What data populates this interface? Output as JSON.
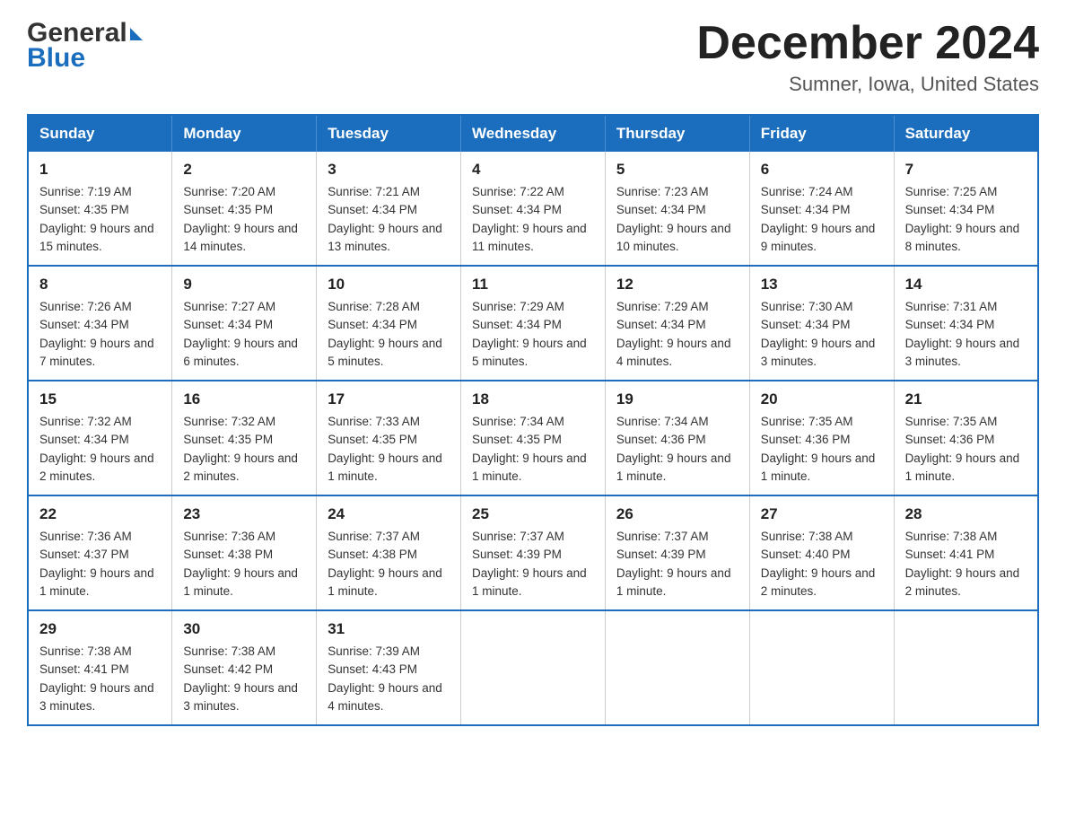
{
  "header": {
    "logo_general": "General",
    "logo_blue": "Blue",
    "month_title": "December 2024",
    "location": "Sumner, Iowa, United States"
  },
  "days_of_week": [
    "Sunday",
    "Monday",
    "Tuesday",
    "Wednesday",
    "Thursday",
    "Friday",
    "Saturday"
  ],
  "weeks": [
    [
      {
        "day": "1",
        "sunrise": "7:19 AM",
        "sunset": "4:35 PM",
        "daylight": "9 hours and 15 minutes."
      },
      {
        "day": "2",
        "sunrise": "7:20 AM",
        "sunset": "4:35 PM",
        "daylight": "9 hours and 14 minutes."
      },
      {
        "day": "3",
        "sunrise": "7:21 AM",
        "sunset": "4:34 PM",
        "daylight": "9 hours and 13 minutes."
      },
      {
        "day": "4",
        "sunrise": "7:22 AM",
        "sunset": "4:34 PM",
        "daylight": "9 hours and 11 minutes."
      },
      {
        "day": "5",
        "sunrise": "7:23 AM",
        "sunset": "4:34 PM",
        "daylight": "9 hours and 10 minutes."
      },
      {
        "day": "6",
        "sunrise": "7:24 AM",
        "sunset": "4:34 PM",
        "daylight": "9 hours and 9 minutes."
      },
      {
        "day": "7",
        "sunrise": "7:25 AM",
        "sunset": "4:34 PM",
        "daylight": "9 hours and 8 minutes."
      }
    ],
    [
      {
        "day": "8",
        "sunrise": "7:26 AM",
        "sunset": "4:34 PM",
        "daylight": "9 hours and 7 minutes."
      },
      {
        "day": "9",
        "sunrise": "7:27 AM",
        "sunset": "4:34 PM",
        "daylight": "9 hours and 6 minutes."
      },
      {
        "day": "10",
        "sunrise": "7:28 AM",
        "sunset": "4:34 PM",
        "daylight": "9 hours and 5 minutes."
      },
      {
        "day": "11",
        "sunrise": "7:29 AM",
        "sunset": "4:34 PM",
        "daylight": "9 hours and 5 minutes."
      },
      {
        "day": "12",
        "sunrise": "7:29 AM",
        "sunset": "4:34 PM",
        "daylight": "9 hours and 4 minutes."
      },
      {
        "day": "13",
        "sunrise": "7:30 AM",
        "sunset": "4:34 PM",
        "daylight": "9 hours and 3 minutes."
      },
      {
        "day": "14",
        "sunrise": "7:31 AM",
        "sunset": "4:34 PM",
        "daylight": "9 hours and 3 minutes."
      }
    ],
    [
      {
        "day": "15",
        "sunrise": "7:32 AM",
        "sunset": "4:34 PM",
        "daylight": "9 hours and 2 minutes."
      },
      {
        "day": "16",
        "sunrise": "7:32 AM",
        "sunset": "4:35 PM",
        "daylight": "9 hours and 2 minutes."
      },
      {
        "day": "17",
        "sunrise": "7:33 AM",
        "sunset": "4:35 PM",
        "daylight": "9 hours and 1 minute."
      },
      {
        "day": "18",
        "sunrise": "7:34 AM",
        "sunset": "4:35 PM",
        "daylight": "9 hours and 1 minute."
      },
      {
        "day": "19",
        "sunrise": "7:34 AM",
        "sunset": "4:36 PM",
        "daylight": "9 hours and 1 minute."
      },
      {
        "day": "20",
        "sunrise": "7:35 AM",
        "sunset": "4:36 PM",
        "daylight": "9 hours and 1 minute."
      },
      {
        "day": "21",
        "sunrise": "7:35 AM",
        "sunset": "4:36 PM",
        "daylight": "9 hours and 1 minute."
      }
    ],
    [
      {
        "day": "22",
        "sunrise": "7:36 AM",
        "sunset": "4:37 PM",
        "daylight": "9 hours and 1 minute."
      },
      {
        "day": "23",
        "sunrise": "7:36 AM",
        "sunset": "4:38 PM",
        "daylight": "9 hours and 1 minute."
      },
      {
        "day": "24",
        "sunrise": "7:37 AM",
        "sunset": "4:38 PM",
        "daylight": "9 hours and 1 minute."
      },
      {
        "day": "25",
        "sunrise": "7:37 AM",
        "sunset": "4:39 PM",
        "daylight": "9 hours and 1 minute."
      },
      {
        "day": "26",
        "sunrise": "7:37 AM",
        "sunset": "4:39 PM",
        "daylight": "9 hours and 1 minute."
      },
      {
        "day": "27",
        "sunrise": "7:38 AM",
        "sunset": "4:40 PM",
        "daylight": "9 hours and 2 minutes."
      },
      {
        "day": "28",
        "sunrise": "7:38 AM",
        "sunset": "4:41 PM",
        "daylight": "9 hours and 2 minutes."
      }
    ],
    [
      {
        "day": "29",
        "sunrise": "7:38 AM",
        "sunset": "4:41 PM",
        "daylight": "9 hours and 3 minutes."
      },
      {
        "day": "30",
        "sunrise": "7:38 AM",
        "sunset": "4:42 PM",
        "daylight": "9 hours and 3 minutes."
      },
      {
        "day": "31",
        "sunrise": "7:39 AM",
        "sunset": "4:43 PM",
        "daylight": "9 hours and 4 minutes."
      },
      null,
      null,
      null,
      null
    ]
  ],
  "labels": {
    "sunrise_prefix": "Sunrise: ",
    "sunset_prefix": "Sunset: ",
    "daylight_prefix": "Daylight: "
  }
}
